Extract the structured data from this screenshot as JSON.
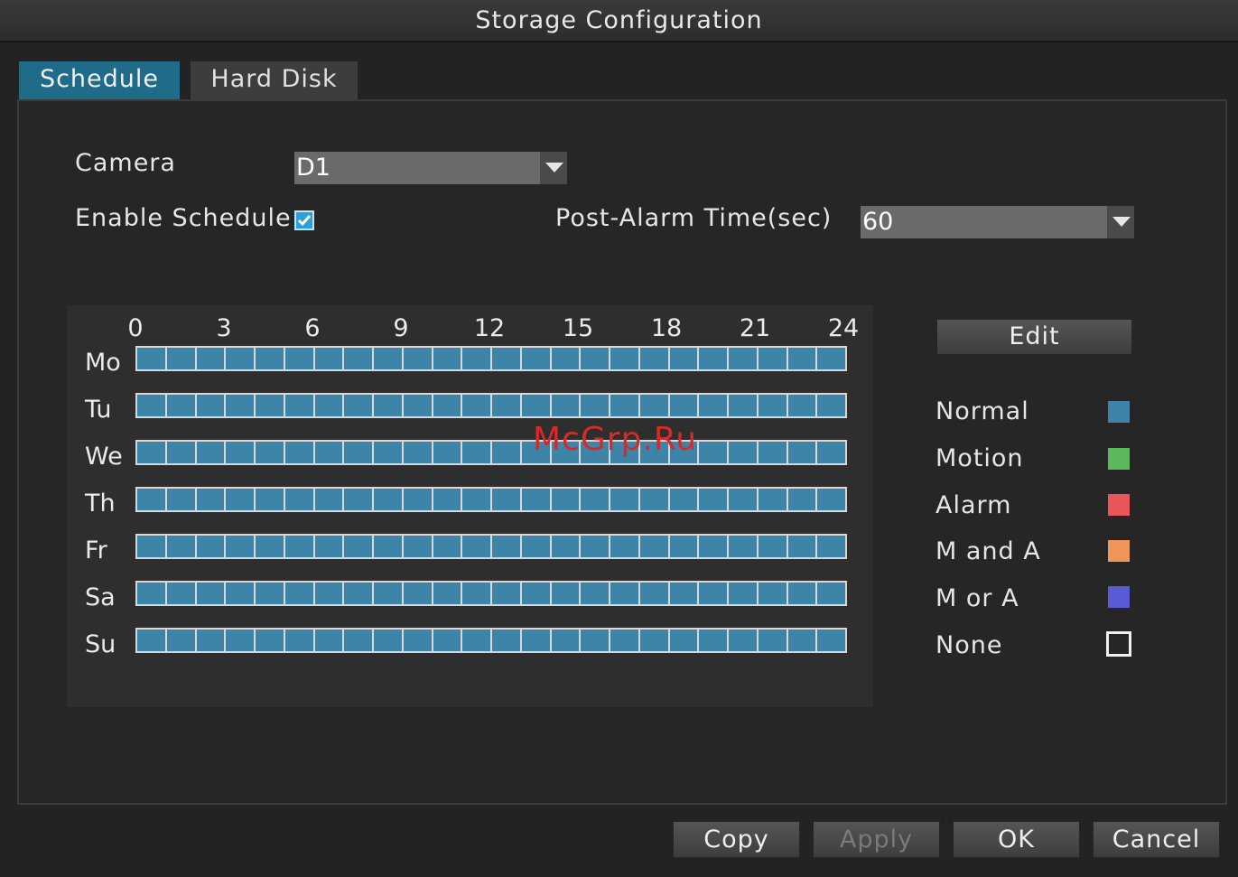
{
  "window": {
    "title": "Storage Configuration"
  },
  "tabs": [
    {
      "label": "Schedule",
      "active": true
    },
    {
      "label": "Hard Disk",
      "active": false
    }
  ],
  "form": {
    "camera_label": "Camera",
    "camera_value": "D1",
    "enable_schedule_label": "Enable Schedule",
    "enable_schedule_checked": true,
    "post_alarm_label": "Post-Alarm Time(sec)",
    "post_alarm_value": "60"
  },
  "schedule": {
    "hours": [
      "0",
      "3",
      "6",
      "9",
      "12",
      "15",
      "18",
      "21",
      "24"
    ],
    "days": [
      "Mo",
      "Tu",
      "We",
      "Th",
      "Fr",
      "Sa",
      "Su"
    ],
    "all_mode": "Normal"
  },
  "edit_label": "Edit",
  "legend": [
    {
      "label": "Normal",
      "color": "#3d84a8"
    },
    {
      "label": "Motion",
      "color": "#5bb85b"
    },
    {
      "label": "Alarm",
      "color": "#e8555a"
    },
    {
      "label": "M and A",
      "color": "#f0965a"
    },
    {
      "label": "M or A",
      "color": "#5a5ad6"
    },
    {
      "label": "None",
      "color": "none"
    }
  ],
  "watermark": "McGrp.Ru",
  "buttons": {
    "copy": "Copy",
    "apply": "Apply",
    "ok": "OK",
    "cancel": "Cancel"
  }
}
